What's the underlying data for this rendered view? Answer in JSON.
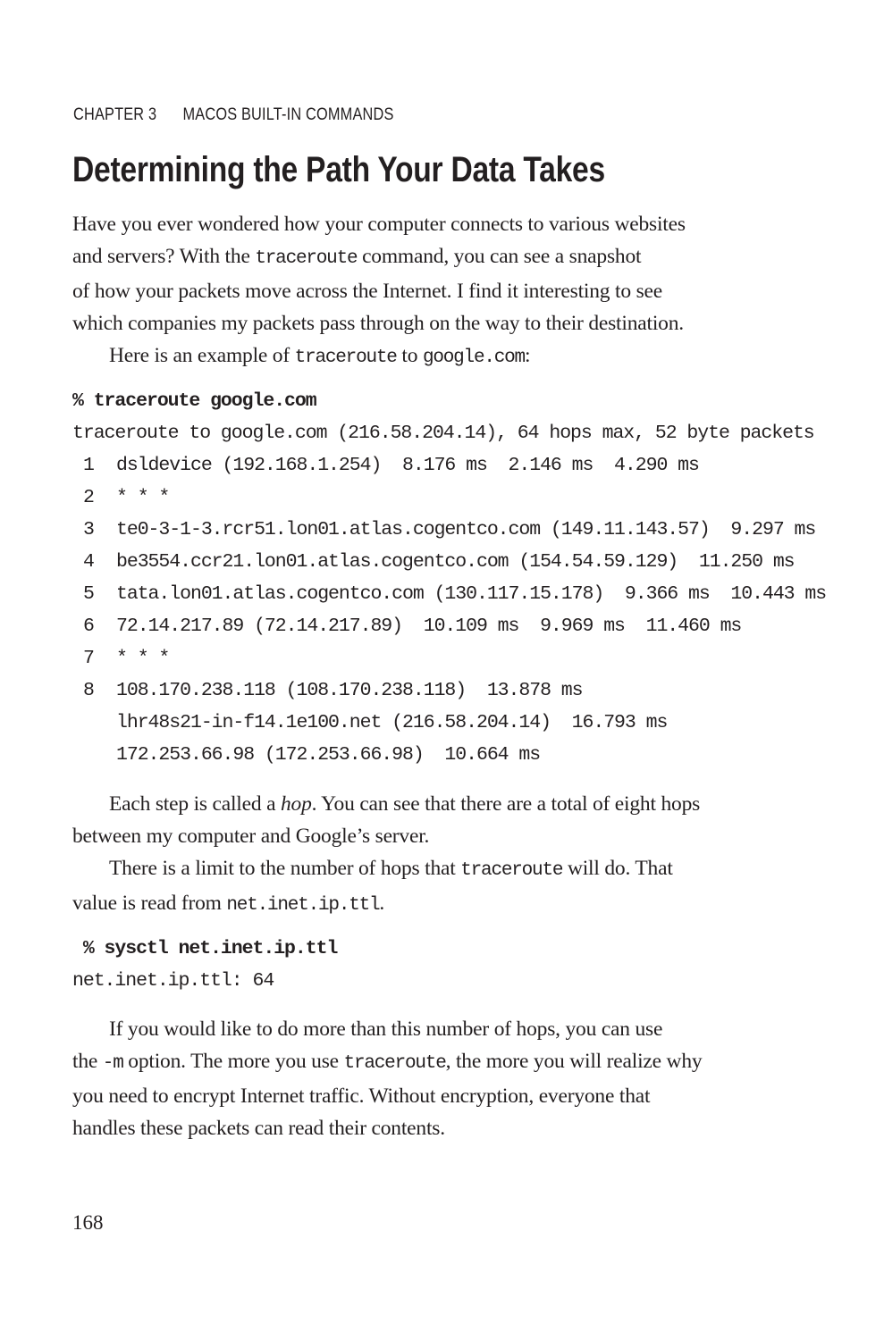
{
  "running_head": {
    "chapter": "CHAPTER 3",
    "title": "MACOS BUILT-IN COMMANDS"
  },
  "section_title": "Determining the Path Your Data Takes",
  "intro_paragraph": {
    "lines": [
      [
        "Have you ever wondered how your computer connects to various websites"
      ],
      [
        "and servers? With the ",
        "traceroute",
        " command, you can see a snapshot"
      ],
      [
        "of how your packets move across the Internet. I find it interesting to see"
      ],
      [
        "which companies my packets pass through on the way to their destination."
      ]
    ],
    "example_line": {
      "pre": "Here is an example of ",
      "cmd": "traceroute",
      "mid": " to ",
      "host": "google.com",
      "post": ":"
    }
  },
  "traceroute_block": {
    "command": "% traceroute google.com",
    "header": "traceroute to google.com (216.58.204.14), 64 hops max, 52 byte packets",
    "hops": [
      {
        "num": "1",
        "text": "dsldevice (192.168.1.254)  8.176 ms  2.146 ms  4.290 ms"
      },
      {
        "num": "2",
        "text": "* * *"
      },
      {
        "num": "3",
        "text": "te0-3-1-3.rcr51.lon01.atlas.cogentco.com (149.11.143.57)  9.297 ms"
      },
      {
        "num": "4",
        "text": "be3554.ccr21.lon01.atlas.cogentco.com (154.54.59.129)  11.250 ms"
      },
      {
        "num": "5",
        "text": "tata.lon01.atlas.cogentco.com (130.117.15.178)  9.366 ms  10.443 ms"
      },
      {
        "num": "6",
        "text": "72.14.217.89 (72.14.217.89)  10.109 ms  9.969 ms  11.460 ms"
      },
      {
        "num": "7",
        "text": "* * *"
      },
      {
        "num": "8",
        "text": "108.170.238.118 (108.170.238.118)  13.878 ms"
      },
      {
        "num": "",
        "text": "lhr48s21-in-f14.1e100.net (216.58.204.14)  16.793 ms"
      },
      {
        "num": "",
        "text": "172.253.66.98 (172.253.66.98)  10.664 ms"
      }
    ]
  },
  "hop_paragraph": {
    "line1_pre": "Each step is called a ",
    "line1_em": "hop",
    "line1_post": ". You can see that there are a total of eight hops",
    "line2": "between my computer and Google’s server."
  },
  "limit_paragraph": {
    "line1_pre": "There is a limit to the number of hops that ",
    "line1_code": "traceroute",
    "line1_post": " will do. That",
    "line2_pre": "value is read from ",
    "line2_code": "net.inet.ip.ttl",
    "line2_post": "."
  },
  "sysctl_block": {
    "command": " % sysctl net.inet.ip.ttl",
    "output": "net.inet.ip.ttl: 64"
  },
  "closing_paragraph": {
    "line1": "If you would like to do more than this number of hops, you can use",
    "line2_pre": "the ",
    "line2_code1": "-m",
    "line2_mid": " option. The more you use ",
    "line2_code2": "traceroute",
    "line2_post": ", the more you will realize why",
    "line3": "you need to encrypt Internet traffic. Without encryption, everyone that",
    "line4": "handles these packets can read their contents."
  },
  "page_number": "168"
}
